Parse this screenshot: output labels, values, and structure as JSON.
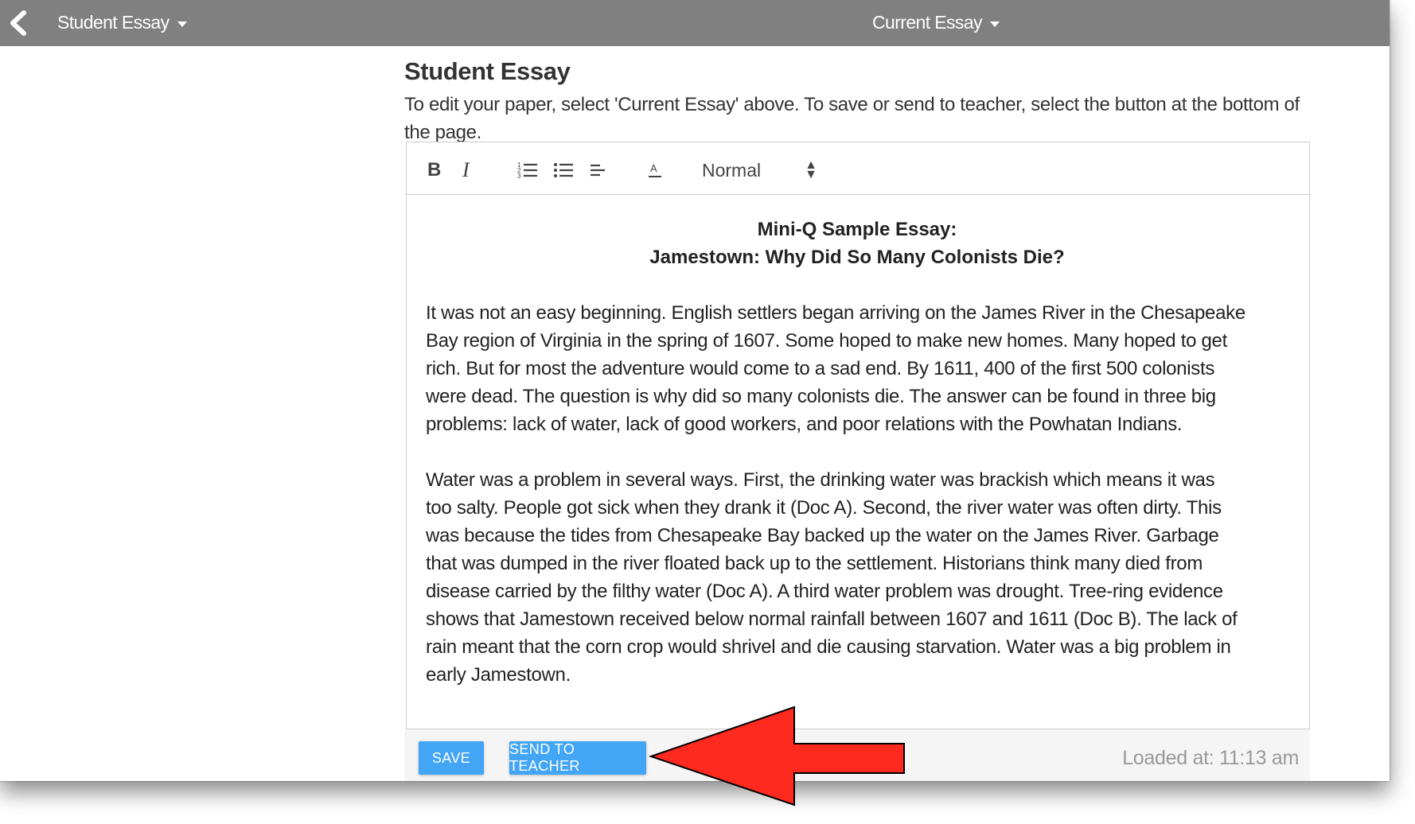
{
  "topbar": {
    "left_dropdown": "Student Essay",
    "center_dropdown": "Current Essay"
  },
  "main": {
    "title": "Student Essay",
    "instructions": "To edit your paper, select 'Current Essay' above. To save or send to teacher, select the button at the bottom of the page."
  },
  "toolbar": {
    "bold_label": "B",
    "italic_label": "I",
    "format_value": "Normal",
    "icons": [
      "ordered-list-icon",
      "bullet-list-icon",
      "align-icon",
      "text-color-icon"
    ]
  },
  "essay": {
    "heading_line1": "Mini-Q Sample Essay:",
    "heading_line2": "Jamestown: Why Did So Many Colonists Die?",
    "paragraph1": "It was not an easy beginning. English settlers began arriving on the James River in the Chesapeake Bay region of Virginia in the spring of 1607. Some hoped to make new homes. Many hoped to get rich. But for most the adventure would come to a sad end. By 1611, 400 of the first 500 colonists were dead. The question is why did so many colonists die. The answer can be found in three big problems: lack of water, lack of good workers, and poor relations with the Powhatan Indians.",
    "paragraph2": "Water was a problem in several ways. First, the drinking water was brackish which means it was too salty. People got sick when they drank it (Doc A). Second, the river water was often dirty. This was because the tides from Chesapeake Bay backed up the water on the James River. Garbage that was dumped in the river floated back up to the settlement. Historians think many died from disease carried by the filthy water (Doc A). A third water problem was drought. Tree-ring evidence shows that Jamestown received below normal rainfall between 1607 and 1611 (Doc B). The lack of rain meant that the corn crop would shrivel and die causing starvation. Water was a big problem in early Jamestown."
  },
  "footer": {
    "save_label": "SAVE",
    "send_label": "SEND TO TEACHER",
    "loaded_text": "Loaded at: 11:13 am"
  },
  "colors": {
    "topbar": "#808080",
    "button": "#42a5f5",
    "arrow": "#ff2a1f"
  }
}
